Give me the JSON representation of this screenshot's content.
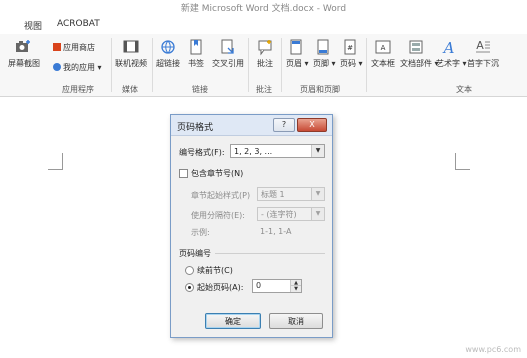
{
  "window": {
    "title": "新建 Microsoft Word 文档.docx - Word"
  },
  "menu": {
    "items": [
      "视图",
      "ACROBAT"
    ]
  },
  "ribbon": {
    "groups": [
      {
        "label": "应用程序",
        "buttons": [
          "屏幕截图"
        ],
        "small": [
          "应用商店",
          "我的应用"
        ]
      },
      {
        "label": "媒体",
        "buttons": [
          "联机视频"
        ]
      },
      {
        "label": "链接",
        "buttons": [
          "超链接",
          "书签",
          "交叉引用"
        ]
      },
      {
        "label": "批注",
        "buttons": [
          "批注"
        ]
      },
      {
        "label": "页眉和页脚",
        "buttons": [
          "页眉",
          "页脚",
          "页码"
        ]
      },
      {
        "label": "文本",
        "buttons": [
          "文本框",
          "文档部件",
          "艺术字",
          "首字下沉"
        ]
      }
    ]
  },
  "dialog": {
    "title": "页码格式",
    "help_btn": "?",
    "close_btn": "X",
    "number_format_label": "编号格式(F):",
    "number_format_value": "1, 2, 3, ...",
    "include_chapter_label": "包含章节号(N)",
    "chapter_style_label": "章节起始样式(P)",
    "chapter_style_value": "标题 1",
    "separator_label": "使用分隔符(E):",
    "separator_value": "- (连字符)",
    "example_label": "示例:",
    "example_value": "1-1, 1-A",
    "page_numbering_label": "页码编号",
    "continue_label": "续前节(C)",
    "start_at_label": "起始页码(A):",
    "start_at_value": "0",
    "ok_label": "确定",
    "cancel_label": "取消"
  },
  "watermark": "www.pc6.com"
}
